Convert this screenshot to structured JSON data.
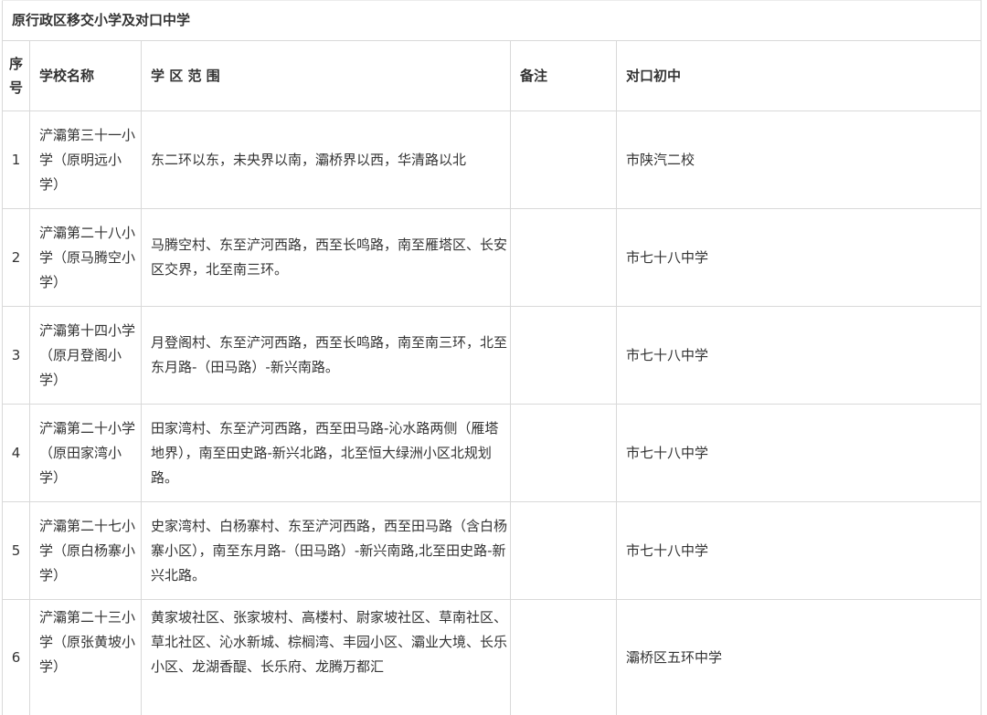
{
  "table": {
    "title": "原行政区移交小学及对口中学",
    "headers": {
      "seq": "序号",
      "school": "学校名称",
      "range": "学 区 范 围",
      "note": "备注",
      "middle": "对口初中"
    },
    "rows": [
      {
        "seq": "1",
        "school": "浐灞第三十一小学（原明远小学）",
        "range": "东二环以东，未央界以南，灞桥界以西，华清路以北",
        "note": "",
        "middle": "市陕汽二校"
      },
      {
        "seq": "2",
        "school": "浐灞第二十八小学（原马腾空小学）",
        "range": "马腾空村、东至浐河西路，西至长鸣路，南至雁塔区、长安区交界，北至南三环。",
        "note": "",
        "middle": "市七十八中学"
      },
      {
        "seq": "3",
        "school": "浐灞第十四小学（原月登阁小学）",
        "range": "月登阁村、东至浐河西路，西至长鸣路，南至南三环，北至东月路-（田马路）-新兴南路。",
        "note": "",
        "middle": "市七十八中学"
      },
      {
        "seq": "4",
        "school": "浐灞第二十小学（原田家湾小学）",
        "range": "田家湾村、东至浐河西路，西至田马路-沁水路两侧（雁塔地界），南至田史路-新兴北路，北至恒大绿洲小区北规划路。",
        "note": "",
        "middle": "市七十八中学"
      },
      {
        "seq": "5",
        "school": "浐灞第二十七小学（原白杨寨小学）",
        "range": "史家湾村、白杨寨村、东至浐河西路，西至田马路（含白杨寨小区），南至东月路-（田马路）-新兴南路,北至田史路-新兴北路。",
        "note": "",
        "middle": "市七十八中学"
      },
      {
        "seq": "6",
        "school": "浐灞第二十三小学（原张黄坡小学）",
        "range": "黄家坡社区、张家坡村、高楼村、尉家坡社区、草南社区、草北社区、沁水新城、棕榈湾、丰园小区、灞业大境、长乐小区、龙湖香醍、长乐府、龙腾万都汇",
        "note": "",
        "middle": "灞桥区五环中学"
      }
    ]
  }
}
